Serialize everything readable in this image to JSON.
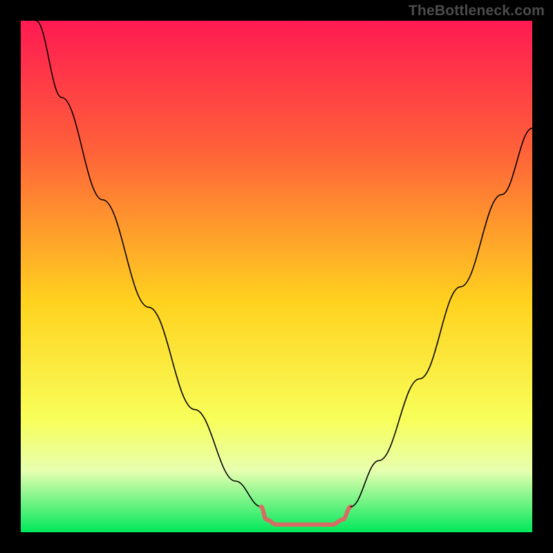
{
  "watermark": "TheBottleneck.com",
  "chart_data": {
    "type": "line",
    "title": "",
    "xlabel": "",
    "ylabel": "",
    "xlim": [
      0,
      100
    ],
    "ylim": [
      0,
      100
    ],
    "gradient_stops": [
      {
        "pos": 0,
        "color": "#ff1a52"
      },
      {
        "pos": 25,
        "color": "#ff603a"
      },
      {
        "pos": 55,
        "color": "#ffd21f"
      },
      {
        "pos": 78,
        "color": "#f8ff5a"
      },
      {
        "pos": 88,
        "color": "#e7ffb0"
      },
      {
        "pos": 100,
        "color": "#00e85a"
      }
    ],
    "ideal_band": {
      "y_from": 96,
      "y_to": 100,
      "color": "#d86b64",
      "opacity": 0
    },
    "series": [
      {
        "name": "bottleneck-left",
        "color": "#000000",
        "width": 1.6,
        "points": [
          {
            "x": 3,
            "y": 0
          },
          {
            "x": 8,
            "y": 15
          },
          {
            "x": 16,
            "y": 35
          },
          {
            "x": 25,
            "y": 56
          },
          {
            "x": 34,
            "y": 76
          },
          {
            "x": 42,
            "y": 90
          },
          {
            "x": 47,
            "y": 95
          }
        ]
      },
      {
        "name": "ideal-flat",
        "color": "#d86b64",
        "width": 6,
        "points": [
          {
            "x": 47,
            "y": 95
          },
          {
            "x": 48,
            "y": 97.5
          },
          {
            "x": 50,
            "y": 98.5
          },
          {
            "x": 56,
            "y": 98.5
          },
          {
            "x": 61,
            "y": 98.5
          },
          {
            "x": 63,
            "y": 97.5
          },
          {
            "x": 64.5,
            "y": 95
          }
        ]
      },
      {
        "name": "bottleneck-right",
        "color": "#000000",
        "width": 1.6,
        "points": [
          {
            "x": 64.5,
            "y": 95
          },
          {
            "x": 70,
            "y": 86
          },
          {
            "x": 78,
            "y": 70
          },
          {
            "x": 86,
            "y": 52
          },
          {
            "x": 94,
            "y": 34
          },
          {
            "x": 100,
            "y": 21
          }
        ]
      }
    ]
  }
}
